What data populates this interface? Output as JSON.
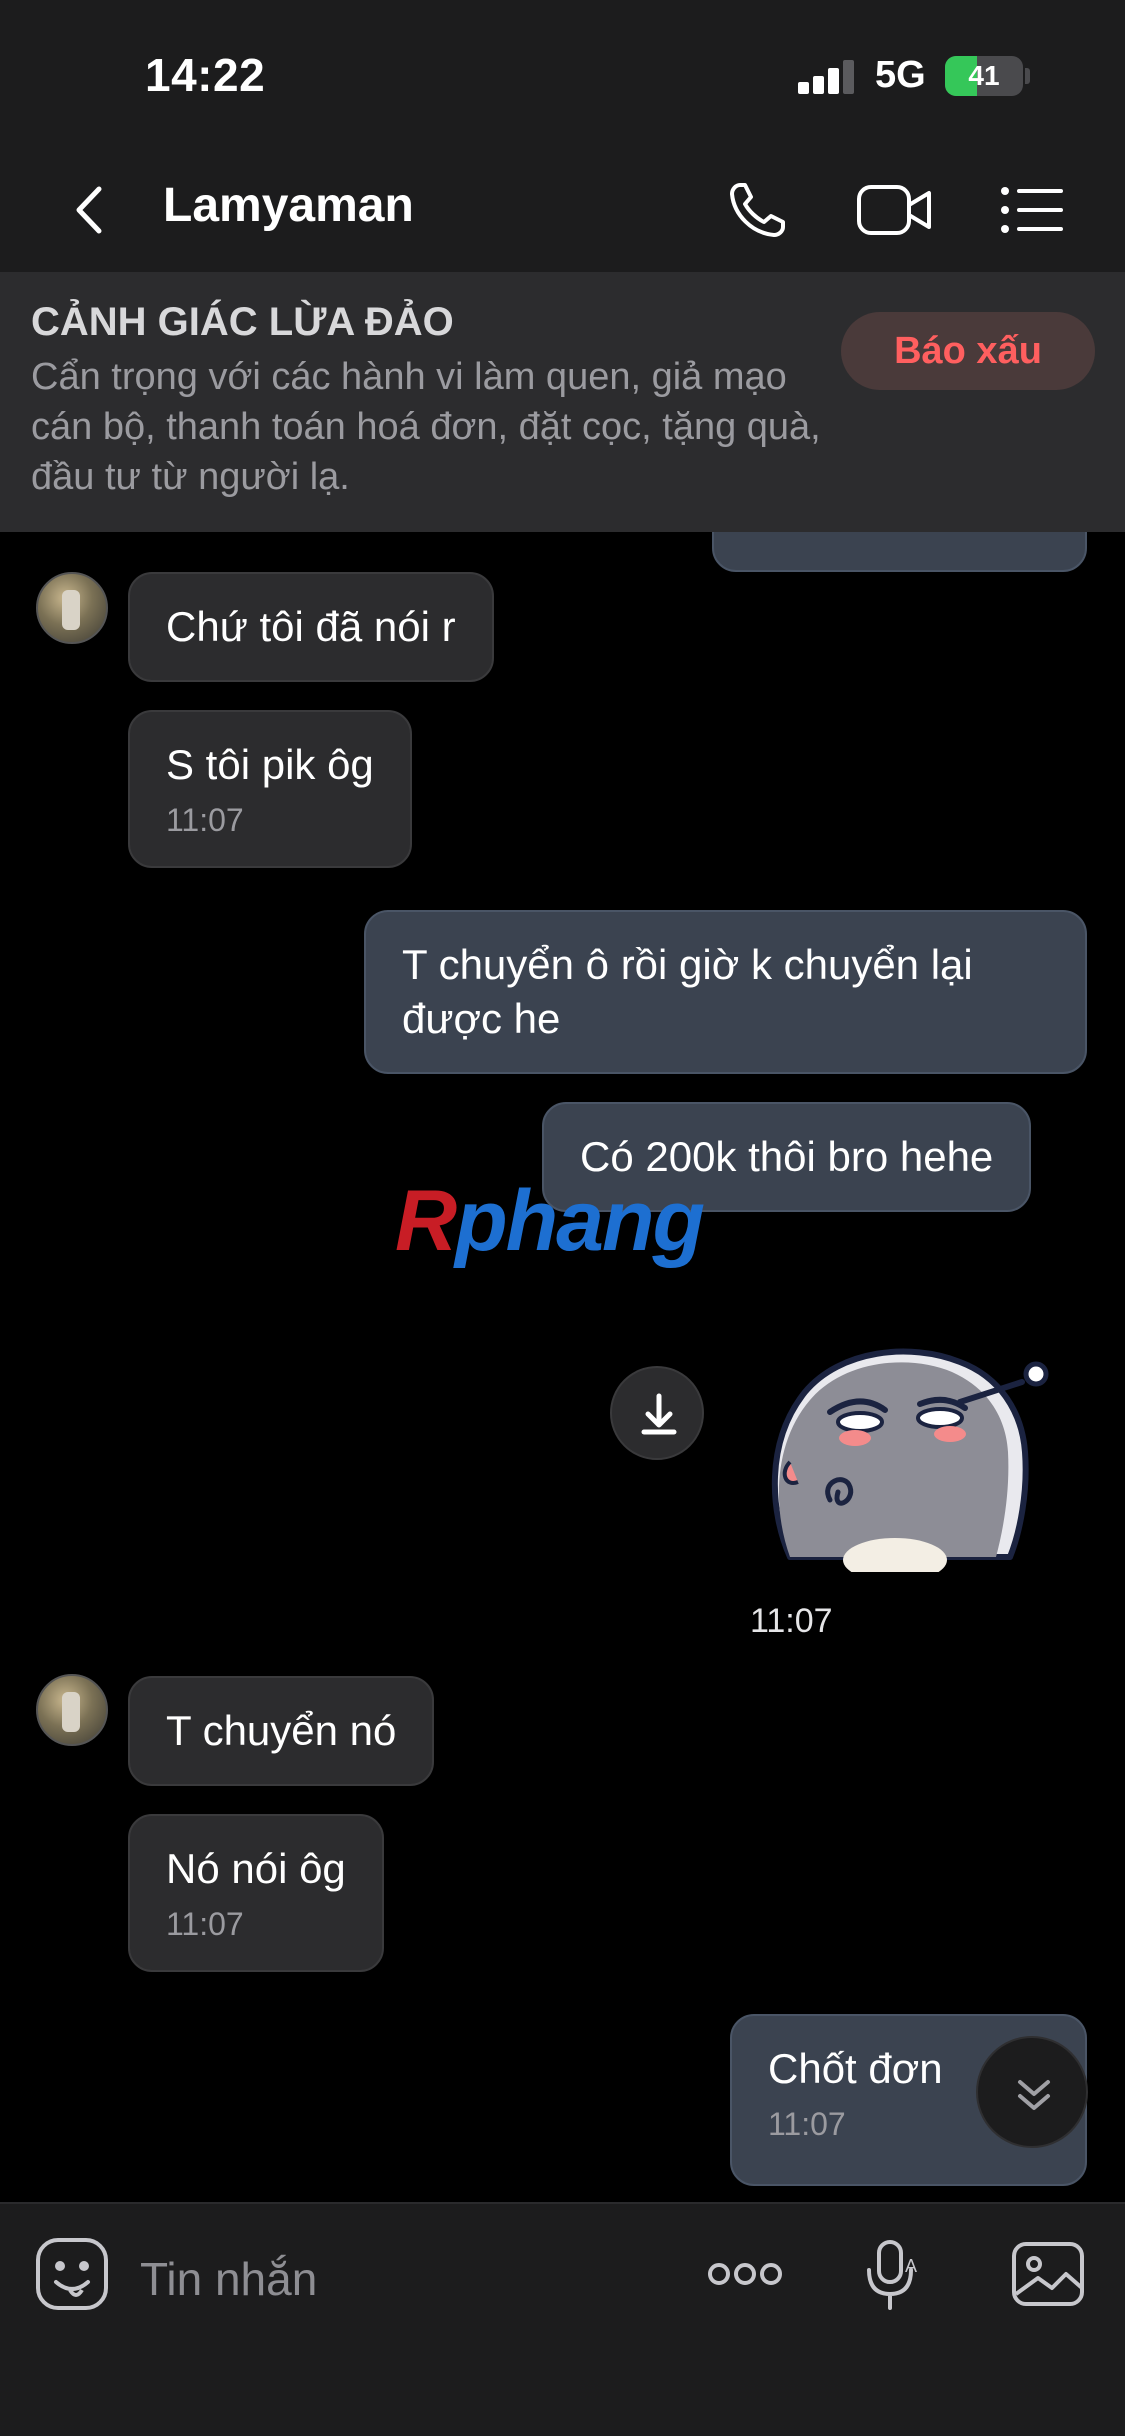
{
  "status_bar": {
    "time": "14:22",
    "network": "5G",
    "battery": "41",
    "battery_level": 0.41
  },
  "header": {
    "title": "Lamyaman",
    "icons": [
      "back-chevron-icon",
      "phone-icon",
      "video-camera-icon",
      "list-menu-icon"
    ]
  },
  "warning": {
    "title": "CẢNH GIÁC LỪA ĐẢO",
    "body": "Cẩn trọng với các hành vi làm quen, giả mạo cán bộ, thanh toán hoá đơn, đặt cọc, tặng quà, đầu tư từ người lạ.",
    "report_button": "Báo xấu"
  },
  "messages": [
    {
      "side": "in",
      "text": "Chứ tôi đã nói r",
      "time": ""
    },
    {
      "side": "in",
      "text": "S tôi pik ôg",
      "time": "11:07"
    },
    {
      "side": "out",
      "text": "T chuyển ô rồi giờ k chuyển lại được he",
      "time": ""
    },
    {
      "side": "out",
      "text": "Có 200k thôi bro hehe",
      "time": ""
    },
    {
      "side": "out",
      "type": "sticker",
      "time": "11:07"
    },
    {
      "side": "in",
      "text": "T chuyển nó",
      "time": ""
    },
    {
      "side": "in",
      "text": "Nó nói ôg",
      "time": "11:07"
    },
    {
      "side": "out",
      "text": "Chốt đơn",
      "time": "11:07"
    }
  ],
  "watermark": {
    "first": "R",
    "rest": "phang"
  },
  "input": {
    "placeholder": "Tin nhắn",
    "icons": [
      "emoji-icon",
      "more-icon",
      "voice-to-text-mic-icon",
      "image-icon"
    ]
  }
}
